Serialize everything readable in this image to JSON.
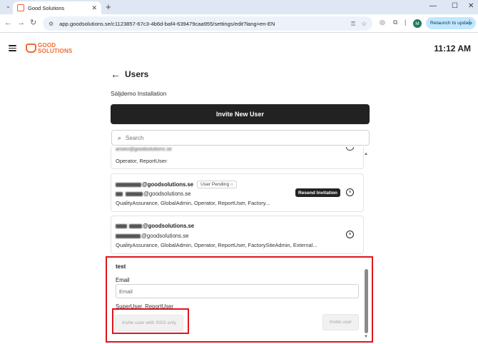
{
  "browser": {
    "tab_title": "Good Solutions",
    "url": "app.goodsolutions.se/c1123857-67c3-4b6d-baf4-639479caa955/settings/edit?lang=en-EN",
    "profile_initial": "M",
    "relaunch_label": "Relaunch to update"
  },
  "app": {
    "logo_line1": "GOOD",
    "logo_line2": "SOLUTIONS",
    "clock": "11:12 AM",
    "brand_color": "#ef6b34"
  },
  "page": {
    "title": "Users",
    "installation": "Säljdemo Installation",
    "invite_new_label": "Invite New User",
    "search_placeholder": "Search"
  },
  "users": {
    "top": {
      "email_partial": "anseo@goodsolutions.se",
      "roles": "Operator, ReportUser"
    },
    "u1": {
      "email_suffix": "@goodsolutions.se",
      "pending_label": "User Pending",
      "sso_suffix": "@goodsolutions.se",
      "resend_label": "Resend Invitation",
      "roles": "QualityAssurance, GlobalAdmin, Operator, ReportUser, Factory..."
    },
    "u2": {
      "email_suffix": "@goodsolutions.se",
      "sso_suffix": "@goodsolutions.se",
      "roles": "QualityAssurance, GlobalAdmin, Operator, ReportUser, FactorySiteAdmin, External..."
    }
  },
  "invite_form": {
    "name": "test",
    "email_label": "Email",
    "email_placeholder": "Email",
    "roles": "SuperUser, ReportUser",
    "sso_button_label": "Invite user with SSO only",
    "invite_button_label": "Invite user"
  }
}
